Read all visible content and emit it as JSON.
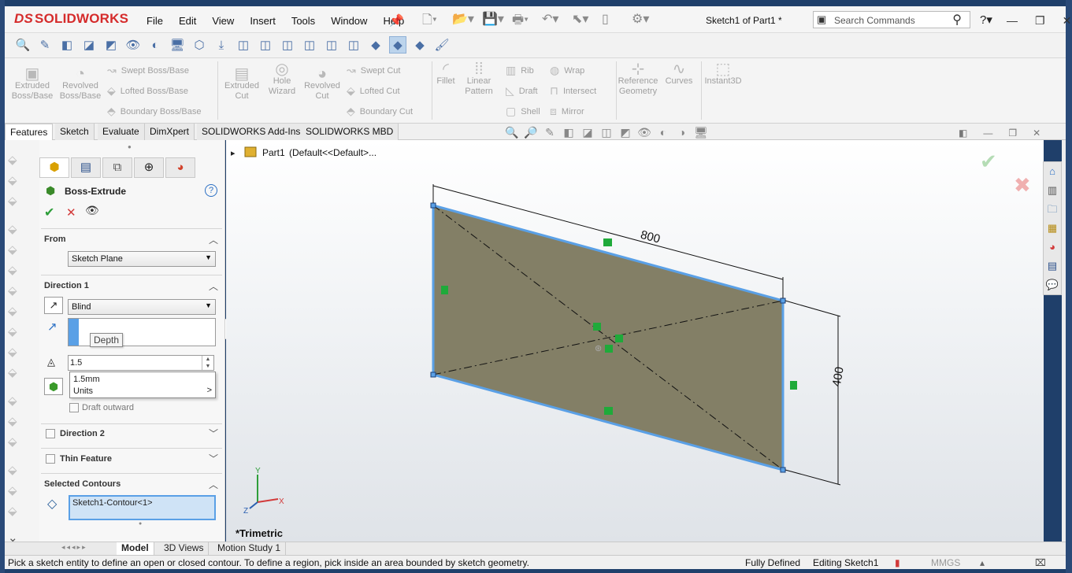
{
  "app": {
    "logo_ds": "DS",
    "logo_text": "SOLIDWORKS"
  },
  "menu": [
    "File",
    "Edit",
    "View",
    "Insert",
    "Tools",
    "Window",
    "Help"
  ],
  "doc_title": "Sketch1 of Part1 *",
  "search": {
    "placeholder": "Search Commands"
  },
  "command_manager": {
    "extruded_boss": "Extruded Boss/Base",
    "revolved_boss": "Revolved Boss/Base",
    "swept_boss": "Swept Boss/Base",
    "lofted_boss": "Lofted Boss/Base",
    "boundary_boss": "Boundary Boss/Base",
    "extruded_cut": "Extruded Cut",
    "hole_wizard": "Hole Wizard",
    "revolved_cut": "Revolved Cut",
    "swept_cut": "Swept Cut",
    "lofted_cut": "Lofted Cut",
    "boundary_cut": "Boundary Cut",
    "fillet": "Fillet",
    "linear_pattern": "Linear Pattern",
    "rib": "Rib",
    "draft": "Draft",
    "shell": "Shell",
    "wrap": "Wrap",
    "intersect": "Intersect",
    "mirror": "Mirror",
    "reference_geometry": "Reference Geometry",
    "curves": "Curves",
    "instant3d": "Instant3D"
  },
  "tabs": [
    "Features",
    "Sketch",
    "Evaluate",
    "DimXpert",
    "SOLIDWORKS Add-Ins",
    "SOLIDWORKS MBD"
  ],
  "property_manager": {
    "title": "Boss-Extrude",
    "help": "?",
    "from_label": "From",
    "from_value": "Sketch Plane",
    "direction1_label": "Direction 1",
    "end_condition": "Blind",
    "depth_tooltip": "Depth",
    "depth_value": "1.5",
    "suggestion_value": "1.5mm",
    "suggestion_units": "Units",
    "draft_outward": "Draft outward",
    "direction2_label": "Direction 2",
    "thin_feature_label": "Thin Feature",
    "selected_contours_label": "Selected Contours",
    "contour_item": "Sketch1-Contour<1>"
  },
  "graphics": {
    "tree_part": "Part1",
    "tree_config": "(Default<<Default>...",
    "dim_width": "800",
    "dim_height": "400",
    "view_name": "*Trimetric",
    "triad_x": "X",
    "triad_y": "Y",
    "triad_z": "Z"
  },
  "bottom_tabs": [
    "Model",
    "3D Views",
    "Motion Study 1"
  ],
  "status": {
    "message": "Pick a sketch entity to define an open or closed contour. To define a region, pick inside an area bounded by sketch geometry.",
    "defined": "Fully Defined",
    "editing": "Editing Sketch1",
    "units": "MMGS"
  },
  "colors": {
    "accent": "#4a90d9",
    "face": "#837f66",
    "ok": "#2e9e3a",
    "cancel": "#d23a3a",
    "brand": "#d52b2b"
  }
}
